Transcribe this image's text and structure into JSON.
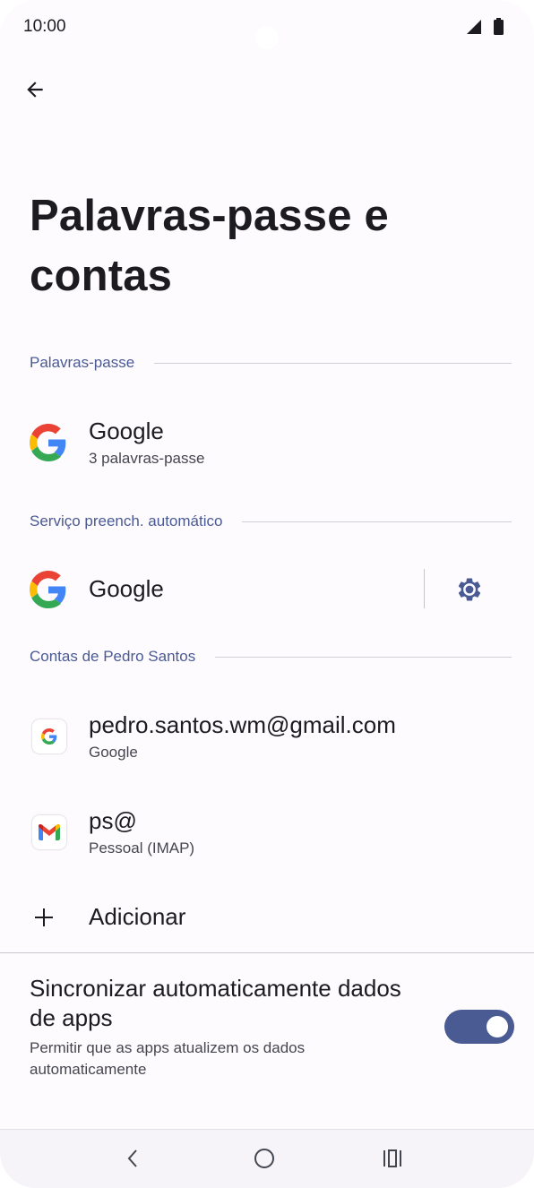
{
  "status_bar": {
    "time": "10:00"
  },
  "page": {
    "title": "Palavras-passe e contas"
  },
  "sections": {
    "passwords": {
      "header": "Palavras-passe",
      "item": {
        "title": "Google",
        "subtitle": "3 palavras-passe",
        "icon": "google-g-icon"
      }
    },
    "autofill": {
      "header": "Serviço preench. automático",
      "item": {
        "title": "Google",
        "icon": "google-g-icon"
      }
    },
    "accounts": {
      "header": "Contas de Pedro Santos",
      "items": [
        {
          "title": "pedro.santos.wm@gmail.com",
          "subtitle": "Google",
          "icon": "google-app-icon"
        },
        {
          "title": "ps@",
          "subtitle": "Pessoal (IMAP)",
          "icon": "gmail-icon"
        }
      ],
      "add_label": "Adicionar"
    }
  },
  "sync": {
    "title": "Sincronizar automaticamente dados de apps",
    "description": "Permitir que as apps atualizem os dados automaticamente",
    "enabled": true
  },
  "colors": {
    "accent": "#4a5a92",
    "google_blue": "#4285f4",
    "google_red": "#ea4335",
    "google_yellow": "#fbbc05",
    "google_green": "#34a853"
  }
}
